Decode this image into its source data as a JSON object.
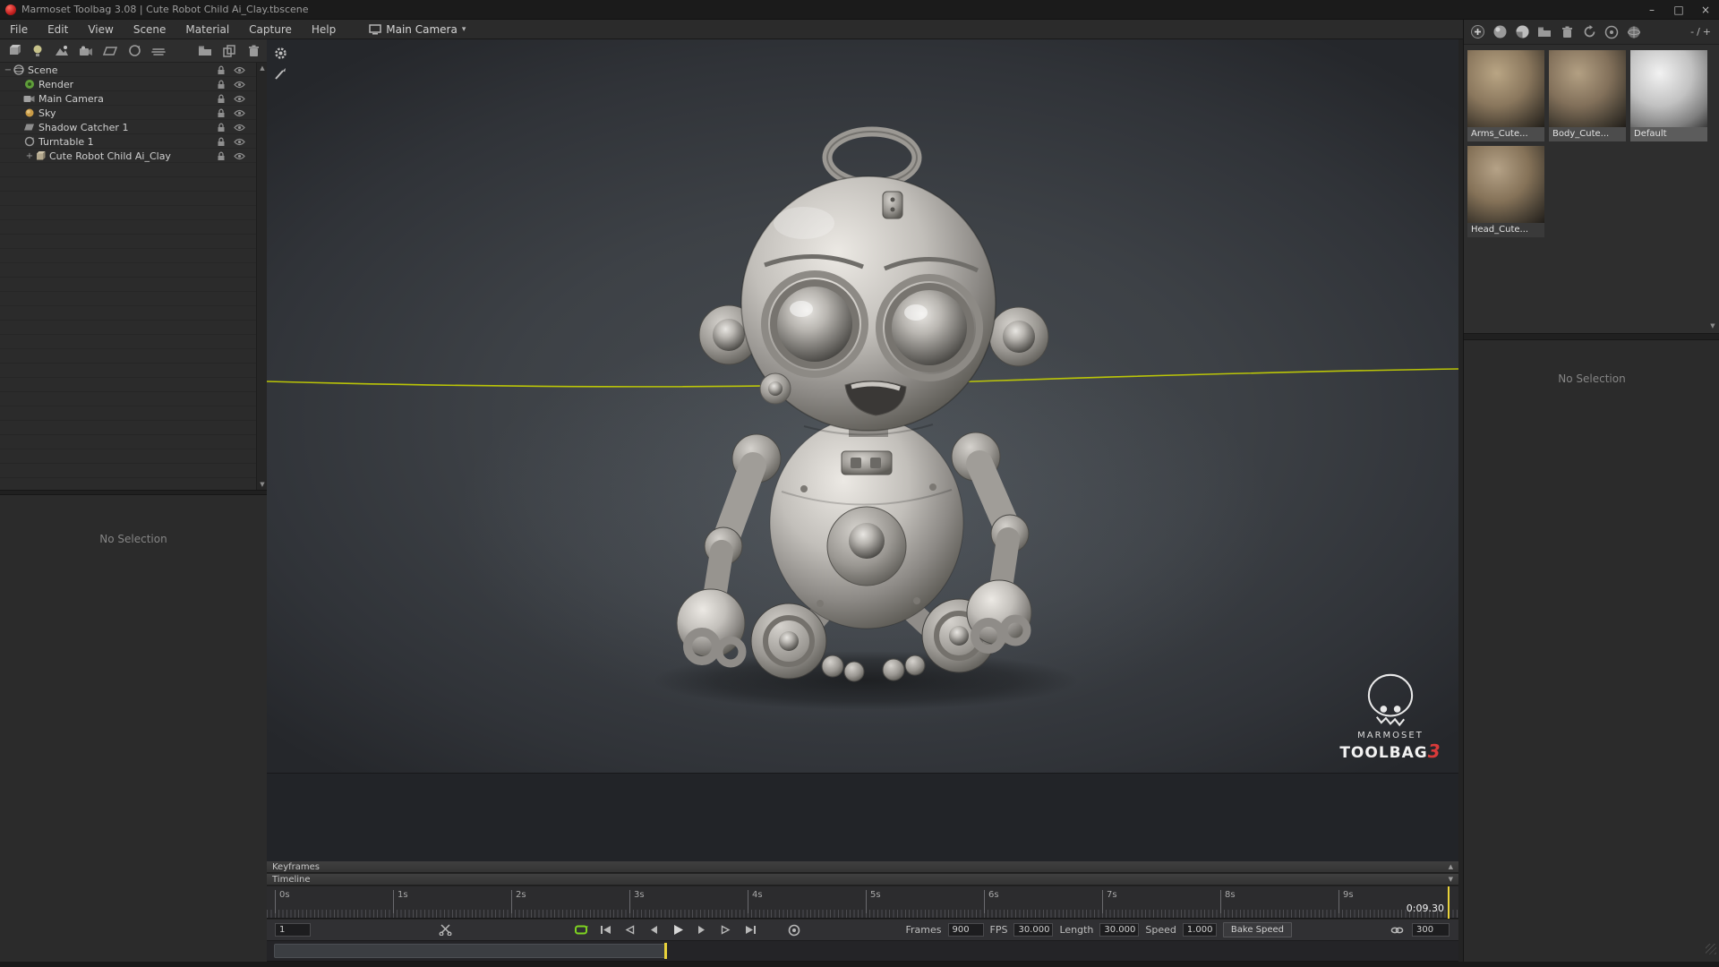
{
  "titlebar": {
    "app_title": "Marmoset Toolbag 3.08  |  Cute Robot Child Ai_Clay.tbscene"
  },
  "icons": {
    "minimize": "–",
    "maximize": "□",
    "close": "×",
    "caret_down": "▾",
    "scroll_up": "▲",
    "scroll_down": "▼"
  },
  "menubar": {
    "items": [
      "File",
      "Edit",
      "View",
      "Scene",
      "Material",
      "Capture",
      "Help"
    ],
    "camera_tab": "Main Camera"
  },
  "scene": {
    "tree": [
      {
        "expander": "−",
        "label": "Scene"
      },
      {
        "expander": "",
        "label": "Render"
      },
      {
        "expander": "",
        "label": "Main Camera"
      },
      {
        "expander": "",
        "label": "Sky"
      },
      {
        "expander": "",
        "label": "Shadow Catcher 1"
      },
      {
        "expander": "",
        "label": "Turntable 1"
      },
      {
        "expander": "+",
        "label": "Cute Robot Child Ai_Clay"
      }
    ],
    "lower_status": "No Selection"
  },
  "materials": {
    "items": [
      {
        "name": "Arms_Cute..."
      },
      {
        "name": "Body_Cute..."
      },
      {
        "name": "Default"
      },
      {
        "name": "Head_Cute..."
      }
    ],
    "size_minus": "-",
    "size_sep": "/",
    "size_plus": "+",
    "lower_status": "No Selection"
  },
  "viewport": {
    "logo_line1": "MARMOSET",
    "logo_line2": "TOOLBAG",
    "logo_number": "3"
  },
  "timeline": {
    "keyframes_label": "Keyframes",
    "timeline_label": "Timeline",
    "ticks": [
      "0s",
      "1s",
      "2s",
      "3s",
      "4s",
      "5s",
      "6s",
      "7s",
      "8s",
      "9s"
    ],
    "current_time": "0:09.30",
    "frame_value": "1",
    "frames_label": "Frames",
    "frames_value": "900",
    "fps_label": "FPS",
    "fps_value": "30.000",
    "length_label": "Length",
    "length_value": "30.000",
    "speed_label": "Speed",
    "speed_value": "1.000",
    "bake_label": "Bake Speed",
    "loop_end_value": "300"
  },
  "colors": {
    "accent_green": "#7ed321",
    "horizon_yellow": "#c9d400",
    "logo_red": "#d93a3a",
    "playhead_yellow": "#e8d23a"
  }
}
